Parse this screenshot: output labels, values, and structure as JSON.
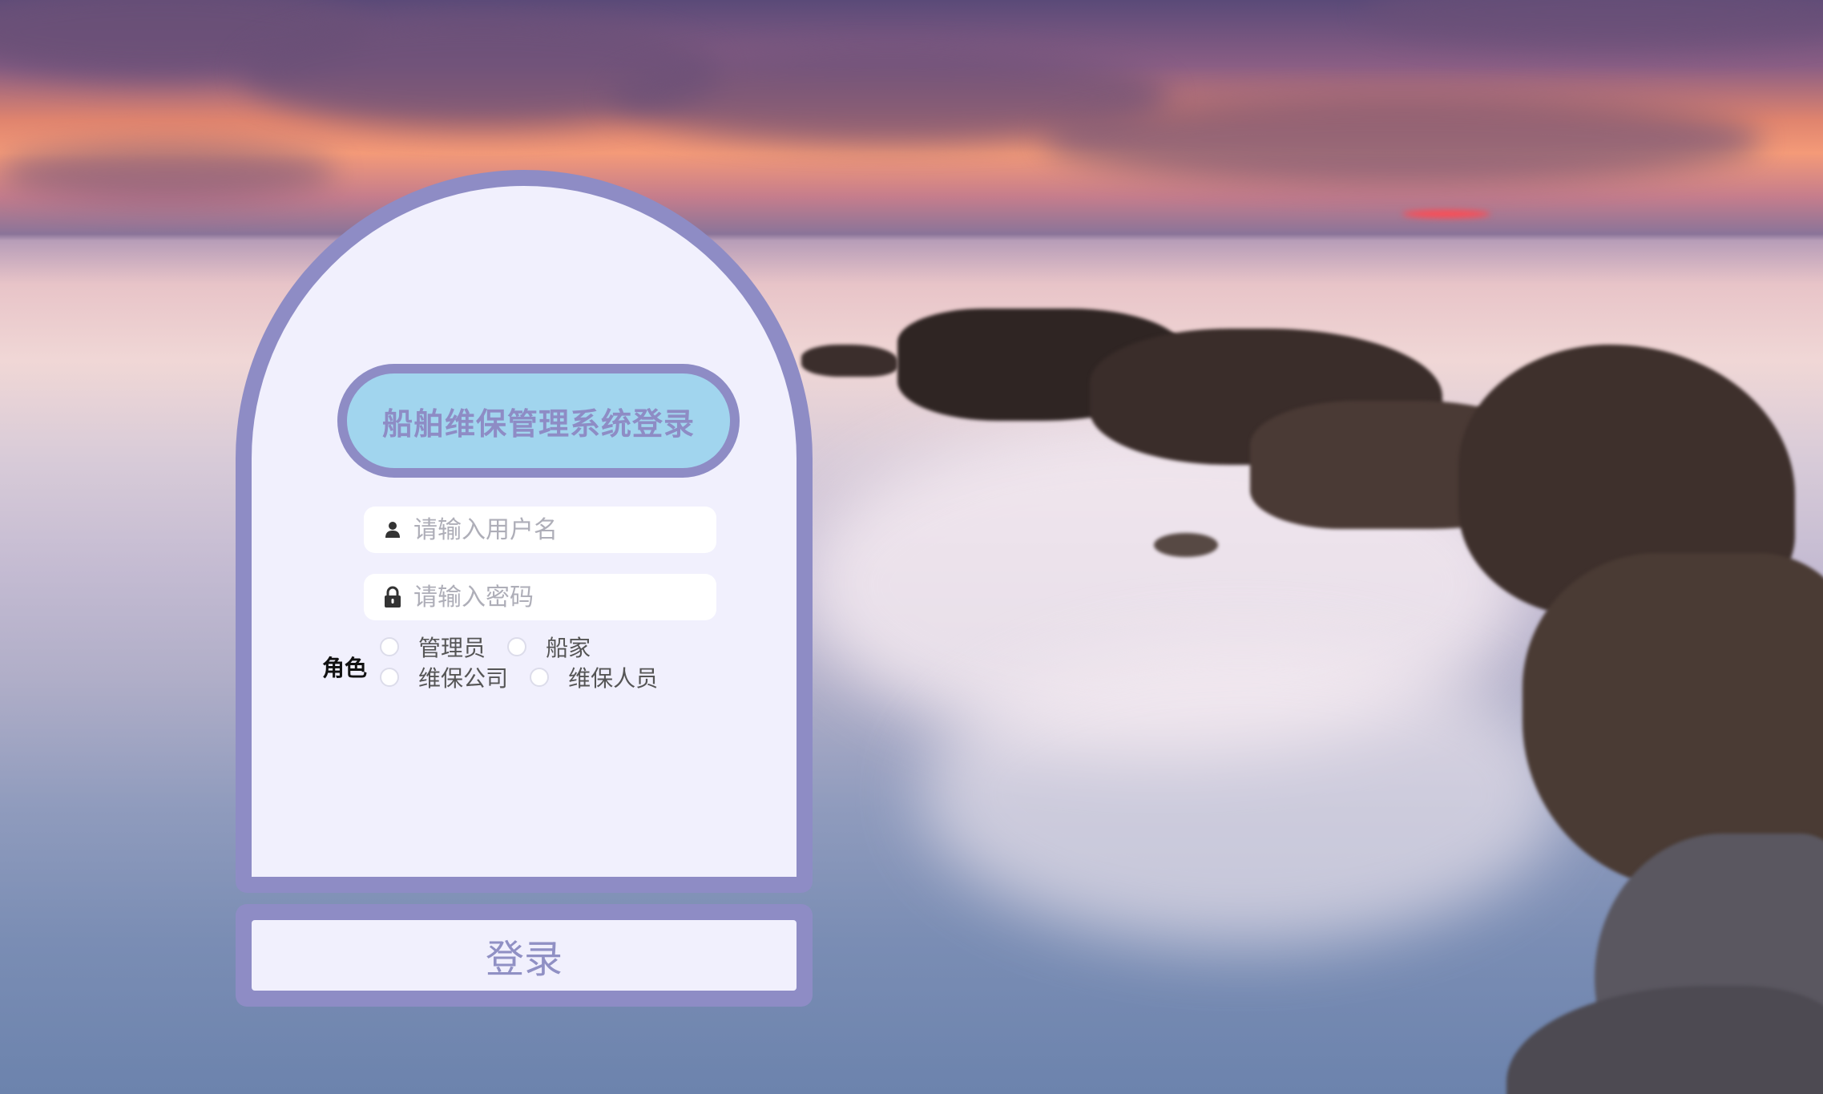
{
  "login": {
    "title": "船舶维保管理系统登录",
    "username_placeholder": "请输入用户名",
    "password_placeholder": "请输入密码",
    "role_label": "角色",
    "roles": [
      "管理员",
      "船家",
      "维保公司",
      "维保人员"
    ],
    "submit_label": "登录"
  },
  "icons": {
    "username": "user-icon",
    "password": "lock-icon"
  },
  "colors": {
    "card_border": "#8e8cc5",
    "card_fill": "#f1f0fd",
    "title_fill": "#a1d5ee",
    "title_text": "#8e8cc5"
  }
}
